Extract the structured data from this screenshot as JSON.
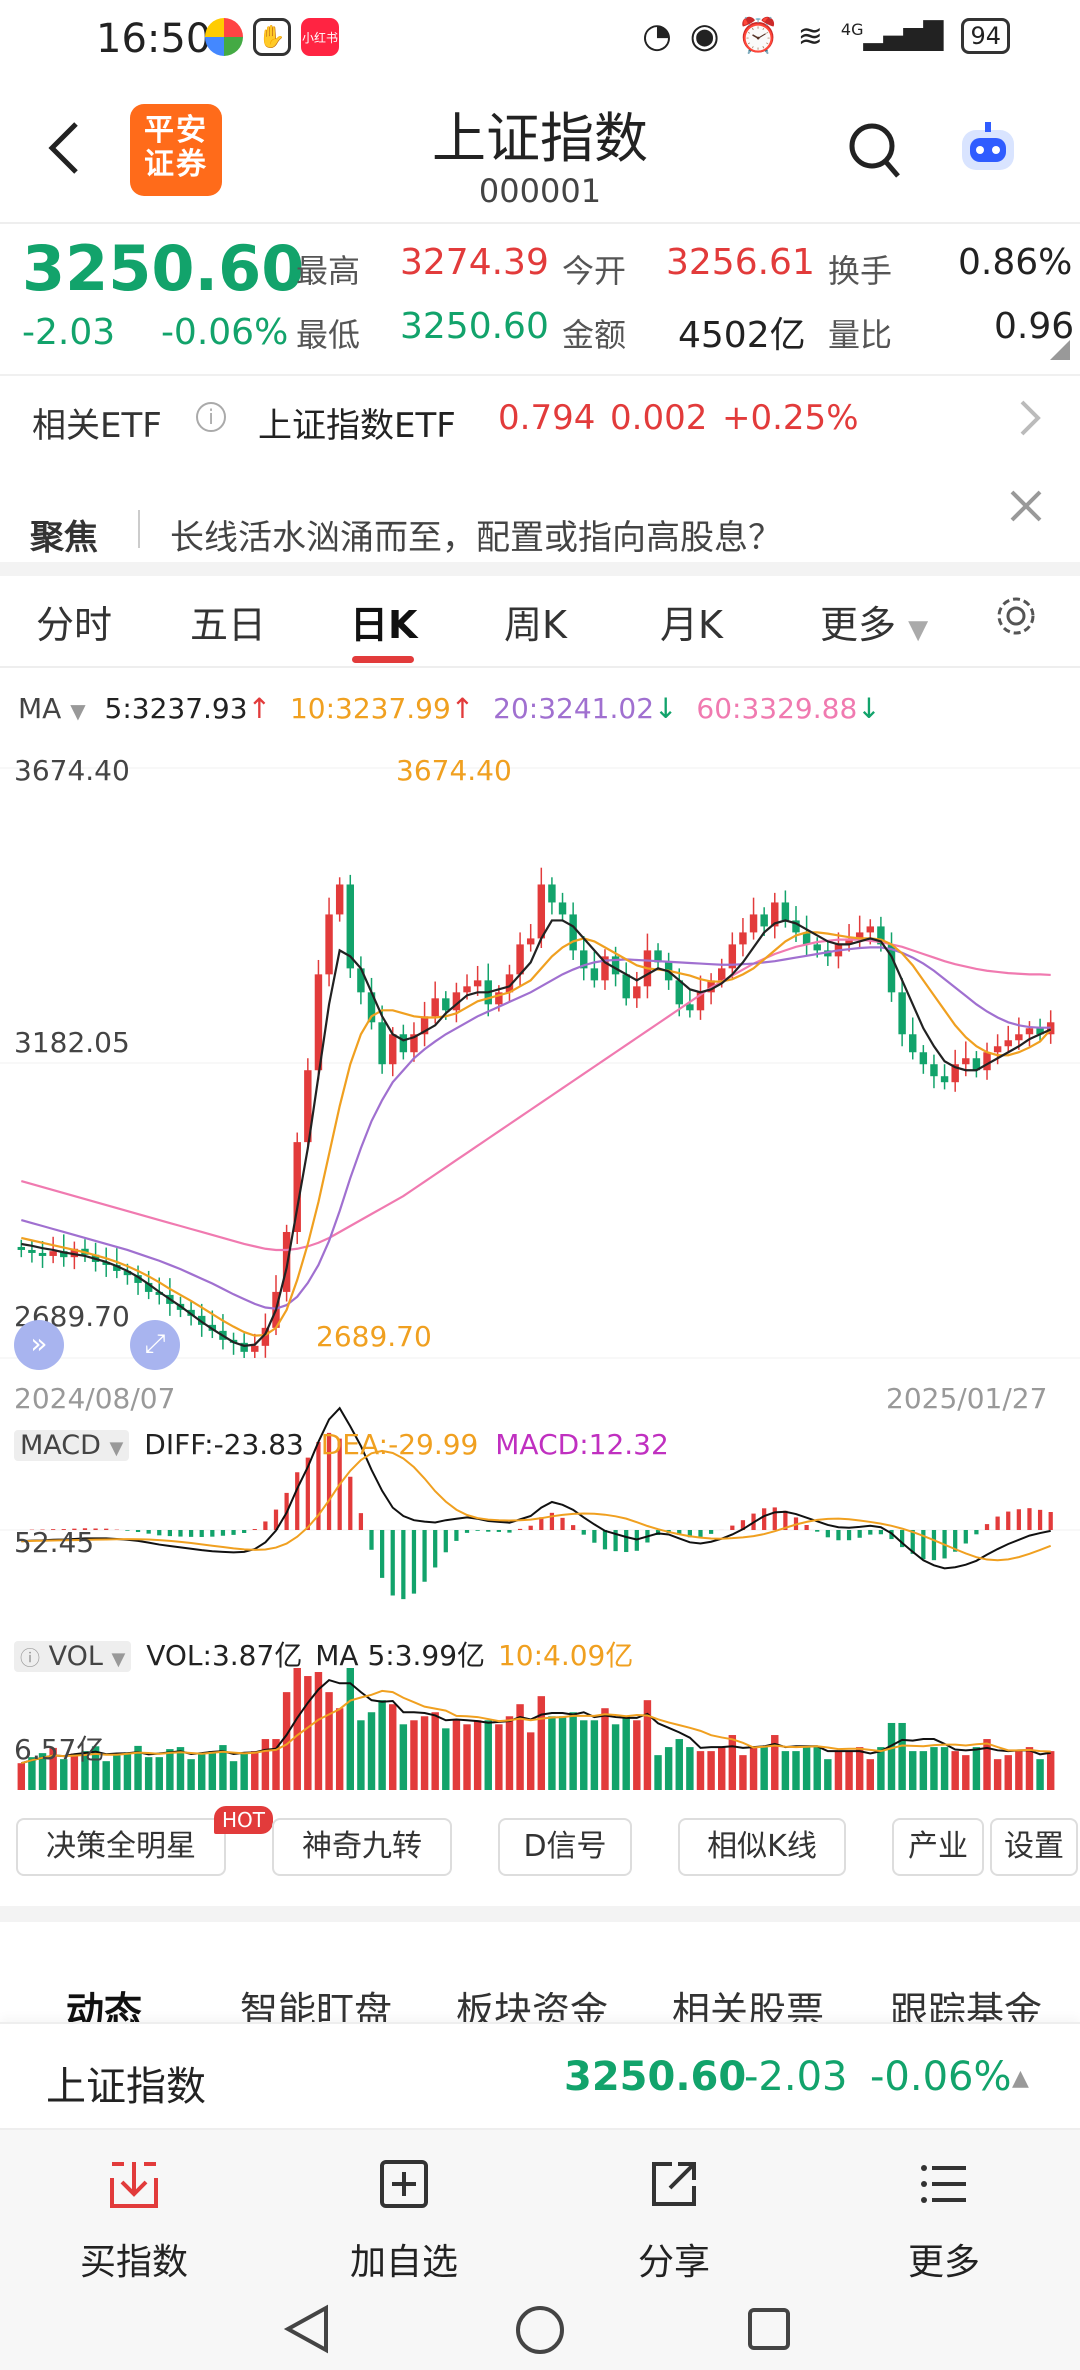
{
  "status_bar": {
    "time": "16:50",
    "app_badge": "小红书",
    "network": "4G",
    "battery": "94"
  },
  "header": {
    "logo_line1": "平安",
    "logo_line2": "证券",
    "title": "上证指数",
    "code": "000001"
  },
  "quote": {
    "price": "3250.60",
    "change": "-2.03",
    "change_pct": "-0.06%",
    "high_label": "最高",
    "high": "3274.39",
    "open_label": "今开",
    "open": "3256.61",
    "turnover_label": "换手",
    "turnover": "0.86%",
    "low_label": "最低",
    "low": "3250.60",
    "amount_label": "金额",
    "amount": "4502亿",
    "volratio_label": "量比",
    "volratio": "0.96"
  },
  "etf": {
    "label": "相关ETF",
    "name": "上证指数ETF",
    "price": "0.794",
    "change": "0.002",
    "pct": "+0.25%"
  },
  "focus": {
    "label": "聚焦",
    "text": "长线活水汹涌而至，配置或指向高股息？"
  },
  "tabs": [
    "分时",
    "五日",
    "日K",
    "周K",
    "月K",
    "更多"
  ],
  "chart_data": {
    "type": "candlestick",
    "ma_legend": {
      "label": "MA",
      "ma5": "5:3237.93",
      "ma10": "10:3237.99",
      "ma20": "20:3241.02",
      "ma60": "60:3329.88"
    },
    "y_labels": {
      "top": "3674.40",
      "mid": "3182.05",
      "bottom": "2689.70"
    },
    "annotations": {
      "max": "3674.40",
      "min": "2689.70"
    },
    "x_labels": {
      "start": "2024/08/07",
      "end": "2025/01/27"
    },
    "ylim": [
      2689.7,
      3674.4
    ],
    "closes": [
      2870,
      2865,
      2860,
      2868,
      2858,
      2872,
      2862,
      2850,
      2845,
      2835,
      2828,
      2815,
      2800,
      2795,
      2780,
      2770,
      2760,
      2745,
      2735,
      2720,
      2715,
      2700,
      2710,
      2740,
      2800,
      2900,
      3050,
      3170,
      3330,
      3430,
      3480,
      3340,
      3300,
      3250,
      3180,
      3230,
      3200,
      3230,
      3260,
      3290,
      3270,
      3300,
      3310,
      3320,
      3280,
      3300,
      3330,
      3380,
      3390,
      3480,
      3450,
      3430,
      3370,
      3340,
      3320,
      3360,
      3330,
      3290,
      3310,
      3370,
      3350,
      3320,
      3280,
      3270,
      3300,
      3320,
      3340,
      3380,
      3400,
      3430,
      3410,
      3450,
      3420,
      3400,
      3380,
      3370,
      3360,
      3380,
      3390,
      3400,
      3410,
      3380,
      3300,
      3230,
      3200,
      3180,
      3160,
      3150,
      3180,
      3190,
      3170,
      3200,
      3210,
      3220,
      3230,
      3240,
      3230,
      3250
    ],
    "ma5": [
      2880,
      2877,
      2873,
      2870,
      2866,
      2863,
      2860,
      2855,
      2850,
      2843,
      2835,
      2825,
      2813,
      2800,
      2788,
      2776,
      2763,
      2750,
      2738,
      2727,
      2716,
      2710,
      2712,
      2730,
      2770,
      2840,
      2940,
      3040,
      3160,
      3280,
      3370,
      3360,
      3340,
      3300,
      3260,
      3230,
      3220,
      3225,
      3235,
      3245,
      3265,
      3280,
      3295,
      3300,
      3300,
      3305,
      3310,
      3330,
      3350,
      3390,
      3420,
      3420,
      3410,
      3390,
      3370,
      3350,
      3340,
      3330,
      3320,
      3330,
      3340,
      3335,
      3320,
      3305,
      3300,
      3305,
      3315,
      3330,
      3350,
      3375,
      3400,
      3415,
      3420,
      3415,
      3405,
      3395,
      3385,
      3380,
      3380,
      3385,
      3390,
      3385,
      3360,
      3320,
      3280,
      3240,
      3210,
      3185,
      3175,
      3170,
      3170,
      3180,
      3190,
      3200,
      3210,
      3222,
      3230,
      3238
    ],
    "ma10": [
      2890,
      2886,
      2882,
      2878,
      2874,
      2870,
      2866,
      2861,
      2856,
      2850,
      2843,
      2835,
      2826,
      2816,
      2805,
      2795,
      2785,
      2774,
      2763,
      2752,
      2742,
      2733,
      2727,
      2728,
      2740,
      2770,
      2820,
      2880,
      2950,
      3030,
      3110,
      3180,
      3230,
      3260,
      3270,
      3270,
      3265,
      3260,
      3258,
      3258,
      3260,
      3265,
      3275,
      3285,
      3290,
      3295,
      3300,
      3310,
      3320,
      3340,
      3360,
      3375,
      3385,
      3390,
      3385,
      3375,
      3365,
      3355,
      3345,
      3340,
      3338,
      3336,
      3332,
      3328,
      3322,
      3318,
      3318,
      3322,
      3330,
      3340,
      3355,
      3370,
      3385,
      3395,
      3400,
      3400,
      3398,
      3395,
      3392,
      3390,
      3390,
      3388,
      3380,
      3365,
      3345,
      3320,
      3295,
      3270,
      3245,
      3225,
      3210,
      3200,
      3195,
      3195,
      3200,
      3208,
      3218,
      3238
    ],
    "ma20": [
      2920,
      2915,
      2910,
      2905,
      2900,
      2895,
      2890,
      2885,
      2880,
      2875,
      2870,
      2864,
      2858,
      2852,
      2845,
      2838,
      2830,
      2822,
      2814,
      2805,
      2796,
      2788,
      2780,
      2774,
      2772,
      2778,
      2792,
      2815,
      2845,
      2885,
      2935,
      2990,
      3040,
      3085,
      3120,
      3150,
      3170,
      3190,
      3205,
      3218,
      3230,
      3240,
      3250,
      3260,
      3268,
      3276,
      3284,
      3292,
      3300,
      3310,
      3320,
      3330,
      3338,
      3345,
      3350,
      3353,
      3354,
      3355,
      3354,
      3353,
      3352,
      3351,
      3350,
      3349,
      3348,
      3347,
      3346,
      3346,
      3347,
      3348,
      3350,
      3352,
      3355,
      3358,
      3361,
      3364,
      3367,
      3370,
      3372,
      3374,
      3375,
      3375,
      3372,
      3366,
      3358,
      3348,
      3336,
      3322,
      3308,
      3294,
      3280,
      3268,
      3258,
      3250,
      3245,
      3242,
      3241,
      3241
    ],
    "ma60": [
      2985,
      2980,
      2975,
      2970,
      2965,
      2960,
      2955,
      2950,
      2945,
      2940,
      2935,
      2930,
      2925,
      2920,
      2915,
      2910,
      2905,
      2900,
      2895,
      2890,
      2885,
      2880,
      2876,
      2872,
      2870,
      2870,
      2872,
      2876,
      2882,
      2890,
      2900,
      2910,
      2920,
      2930,
      2940,
      2950,
      2960,
      2972,
      2984,
      2996,
      3008,
      3020,
      3032,
      3044,
      3056,
      3068,
      3080,
      3092,
      3104,
      3116,
      3128,
      3140,
      3152,
      3164,
      3176,
      3188,
      3200,
      3212,
      3224,
      3236,
      3248,
      3260,
      3272,
      3284,
      3296,
      3308,
      3318,
      3328,
      3338,
      3348,
      3356,
      3364,
      3370,
      3376,
      3380,
      3384,
      3386,
      3388,
      3388,
      3388,
      3386,
      3384,
      3380,
      3376,
      3370,
      3364,
      3358,
      3352,
      3347,
      3343,
      3339,
      3336,
      3334,
      3332,
      3331,
      3330,
      3330,
      3329
    ],
    "macd_legend": {
      "label": "MACD",
      "diff": "DIFF:-23.83",
      "dea": "DEA:-29.99",
      "macd": "MACD:12.32"
    },
    "macd_y": "52.45",
    "vol_legend": {
      "label": "VOL",
      "vol": "VOL:3.87亿",
      "ma5": "MA 5:3.99亿",
      "ma10": "10:4.09亿"
    },
    "vol_y": "6.57亿"
  },
  "colors": {
    "up": "#e23b3b",
    "down": "#12a36b",
    "ma5": "#222222",
    "ma10": "#f0a020",
    "ma20": "#a070d0",
    "ma60": "#f07ab0"
  },
  "tools": [
    "决策全明星",
    "神奇九转",
    "D信号",
    "相似K线",
    "产业",
    "设置"
  ],
  "tools_hot": "HOT",
  "subtabs": [
    "动态",
    "智能盯盘",
    "板块资金",
    "相关股票",
    "跟踪基金"
  ],
  "bottom_quote": {
    "name": "上证指数",
    "price": "3250.60",
    "change": "-2.03",
    "pct": "-0.06%"
  },
  "bottom_nav": [
    "买指数",
    "加自选",
    "分享",
    "更多"
  ]
}
